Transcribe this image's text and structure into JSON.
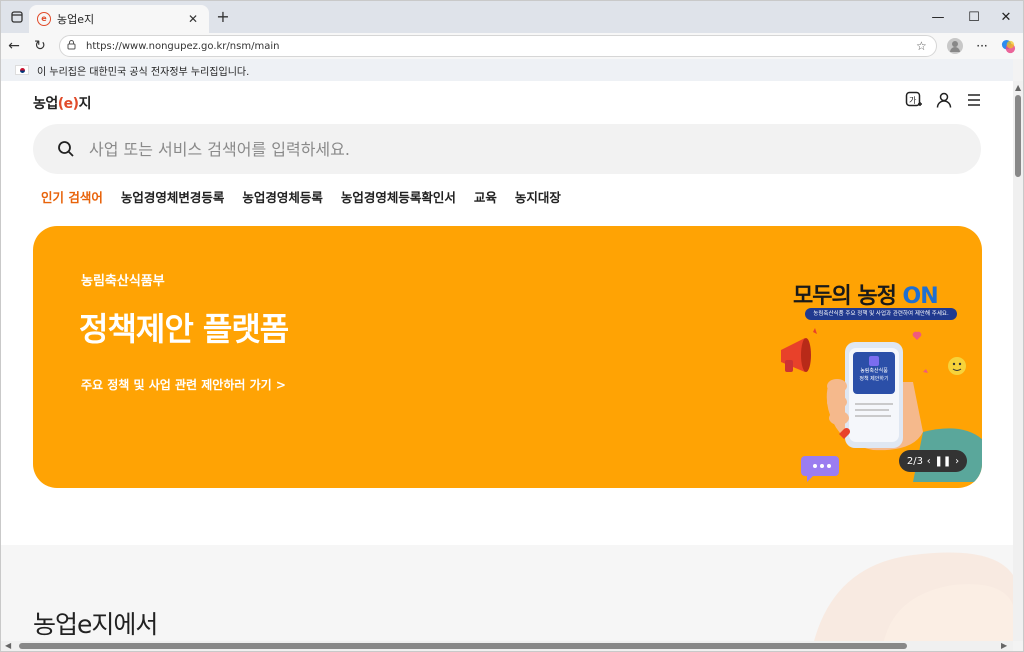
{
  "browser": {
    "tab_title": "농업e지",
    "tab_favicon_text": "e",
    "url": "https://www.nongupez.go.kr/nsm/main",
    "icons": [
      "tab-actions-icon",
      "close-icon",
      "plus-icon",
      "minimize-icon",
      "maximize-icon",
      "close-window-icon",
      "back-arrow-icon",
      "refresh-icon",
      "lock-icon",
      "star-icon",
      "profile-icon",
      "more-icon",
      "copilot-icon"
    ]
  },
  "gov_banner": {
    "text": "이 누리집은 대한민국 공식 전자정부 누리집입니다."
  },
  "header": {
    "logo_prefix": "농업",
    "logo_e": "e",
    "logo_suffix": "지",
    "icons": [
      "language-icon",
      "user-icon",
      "menu-icon"
    ]
  },
  "search": {
    "placeholder": "사업 또는 서비스 검색어를 입력하세요."
  },
  "popular": {
    "label": "인기 검색어",
    "keywords": [
      "농업경영체변경등록",
      "농업경영체등록",
      "농업경영체등록확인서",
      "교육",
      "농지대장"
    ]
  },
  "banner": {
    "org": "농림축산식품부",
    "title": "정책제안 플랫폼",
    "link": "주요 정책 및 사업 관련 제안하러 가기 >",
    "campaign_main": "모두의 농정",
    "campaign_on": "ON",
    "campaign_sub": "농림축산식품 주요 정책 및 사업과 관련하여 제안해 주세요.",
    "phone_text": "농림축산식품 정책 제안하기",
    "pager": "2/3",
    "background": "#ffa304"
  },
  "section": {
    "title": "농업e지에서"
  }
}
